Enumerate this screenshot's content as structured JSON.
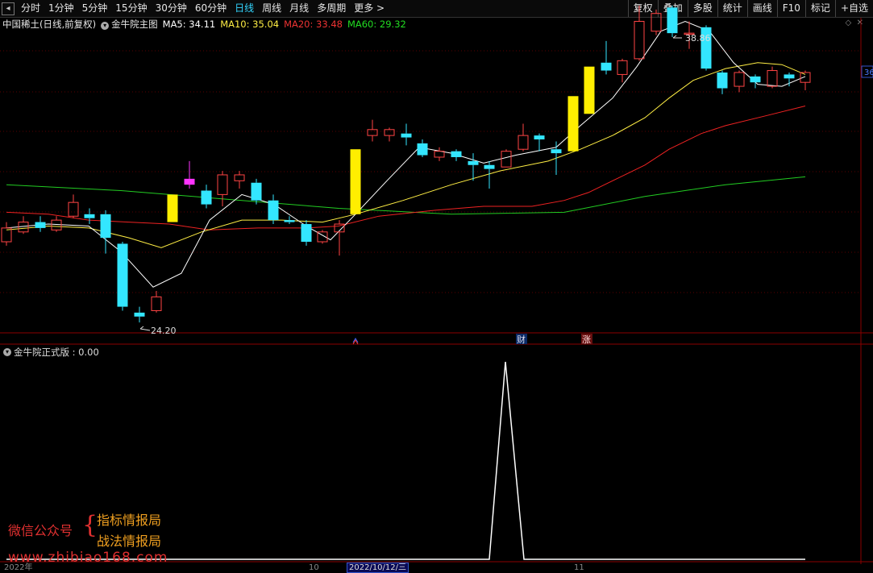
{
  "toolbar": {
    "periods": [
      {
        "label": "分时",
        "active": false
      },
      {
        "label": "1分钟",
        "active": false
      },
      {
        "label": "5分钟",
        "active": false
      },
      {
        "label": "15分钟",
        "active": false
      },
      {
        "label": "30分钟",
        "active": false
      },
      {
        "label": "60分钟",
        "active": false
      },
      {
        "label": "日线",
        "active": true
      },
      {
        "label": "周线",
        "active": false
      },
      {
        "label": "月线",
        "active": false
      },
      {
        "label": "多周期",
        "active": false
      },
      {
        "label": "更多 >",
        "active": false
      }
    ],
    "right_buttons": [
      "复权",
      "叠加",
      "多股",
      "统计",
      "画线",
      "F10",
      "标记",
      "+自选"
    ]
  },
  "info": {
    "stock": "中国稀土(日线,前复权)",
    "indicator": "金牛院主图",
    "ma5": "MA5: 34.11",
    "ma10": "MA10: 35.04",
    "ma20": "MA20: 33.48",
    "ma60": "MA60: 29.32"
  },
  "price_labels": {
    "high": "38.86",
    "low": "24.20",
    "right_edge": "36"
  },
  "event_markers": [
    "财",
    "涨"
  ],
  "indicator_panel": {
    "title": "金牛院正式版 : 0.00"
  },
  "watermark": {
    "label": "微信公众号",
    "line1": "指标情报局",
    "line2": "战法情报局",
    "url": "www.zhibiao168.com"
  },
  "date_axis": {
    "left": "2022年",
    "mid": "10",
    "selected": "2022/10/12/三",
    "right": "11"
  },
  "colors": {
    "up": "#ff4444",
    "down": "#33e6ff",
    "signal": "#ffee00",
    "magenta": "#ff33ff",
    "ma5": "#ffffff",
    "ma10": "#ffee44",
    "ma20": "#ee2222",
    "ma60": "#22cc22"
  }
}
